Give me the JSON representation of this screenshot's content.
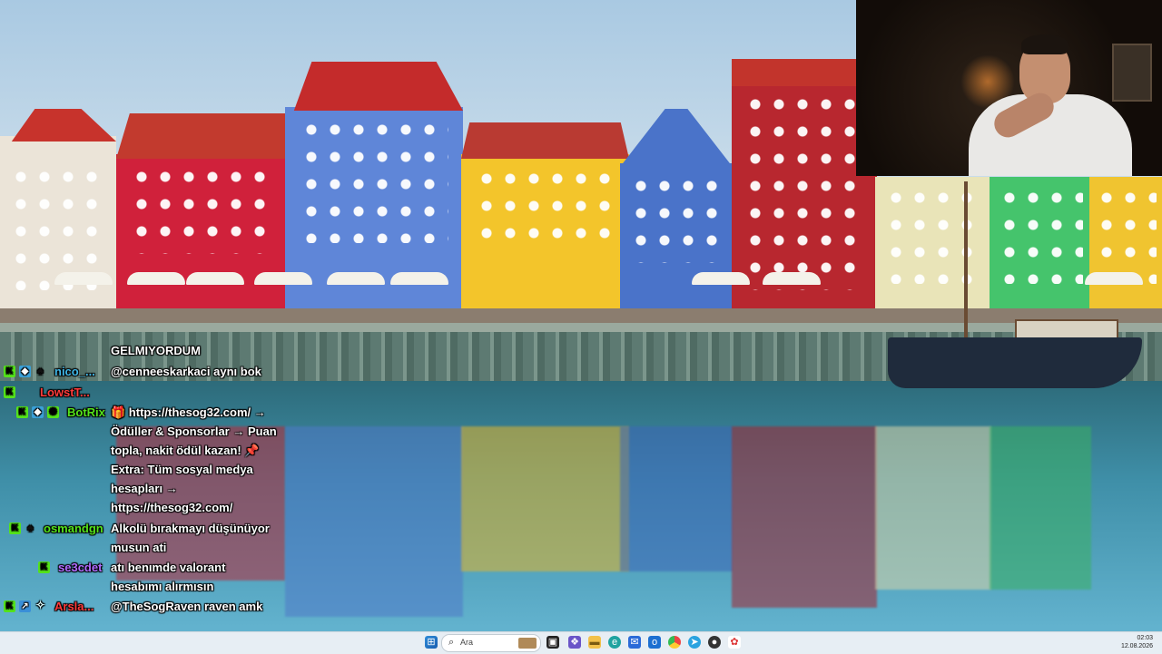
{
  "webcam": {
    "label": ""
  },
  "chat": {
    "messages": [
      {
        "user": "",
        "user_color": "#ffffff",
        "badges": [],
        "text": "GELMIYORDUM"
      },
      {
        "user": "nico_...",
        "user_color": "#3fb7e8",
        "badges": [
          "k-badge",
          "sub-badge",
          "spade-badge"
        ],
        "text": "@cenneeskarkaci aynı bok"
      },
      {
        "user": "LowstT...",
        "user_color": "#ff3b3b",
        "badges": [
          "k-badge"
        ],
        "text": ""
      },
      {
        "user": "BotRix",
        "user_color": "#54e31a",
        "badges": [
          "k-badge",
          "sub-badge",
          "bot-badge"
        ],
        "text": "🎁 https://thesog32.com/ → Ödüller & Sponsorlar → Puan topla, nakit ödül kazan! 📌 Extra: Tüm sosyal medya hesapları → https://thesog32.com/"
      },
      {
        "user": "osmandgn",
        "user_color": "#54e31a",
        "badges": [
          "k-badge",
          "spade-badge"
        ],
        "text": "Alkolü bırakmayı düşünüyor musun ati"
      },
      {
        "user": "se3cdet",
        "user_color": "#b26cff",
        "badges": [
          "k-badge"
        ],
        "text": "atı benımde valorant hesabımı alırmısın"
      },
      {
        "user": "Arsla...",
        "user_color": "#ff3b3b",
        "badges": [
          "k-badge",
          "sword-badge",
          "arrow-badge"
        ],
        "text": "@TheSogRaven raven amk"
      }
    ]
  },
  "taskbar": {
    "search_placeholder": "Ara",
    "start_icon": "windows-start-icon",
    "apps": [
      "task-view-icon",
      "widgets-icon",
      "file-explorer-icon",
      "edge-icon",
      "mail-icon",
      "chrome-icon",
      "telegram-icon",
      "obs-icon",
      "paint-icon"
    ],
    "clock_time": "02:03",
    "clock_date": "12.08.2026"
  }
}
